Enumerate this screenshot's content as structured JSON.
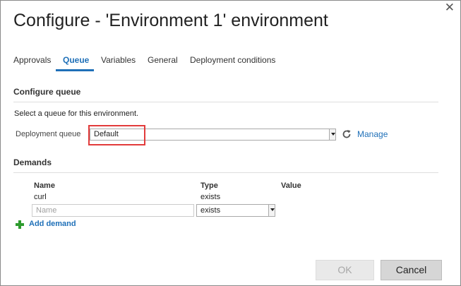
{
  "dialog": {
    "title": "Configure - 'Environment 1' environment",
    "close_label": "✕"
  },
  "tabs": [
    {
      "label": "Approvals",
      "active": false
    },
    {
      "label": "Queue",
      "active": true
    },
    {
      "label": "Variables",
      "active": false
    },
    {
      "label": "General",
      "active": false
    },
    {
      "label": "Deployment conditions",
      "active": false
    }
  ],
  "queue_section": {
    "title": "Configure queue",
    "instruction": "Select a queue for this environment.",
    "field_label": "Deployment queue",
    "selected_value": "Default",
    "manage_label": "Manage"
  },
  "demands_section": {
    "title": "Demands",
    "columns": [
      "Name",
      "Type",
      "Value"
    ],
    "rows": [
      {
        "name": "curl",
        "type": "exists"
      }
    ],
    "new_row": {
      "name_placeholder": "Name",
      "type_value": "exists"
    },
    "add_label": "Add demand"
  },
  "buttons": {
    "ok_label": "OK",
    "cancel_label": "Cancel"
  },
  "colors": {
    "accent": "#1f70b8",
    "highlight": "#e23b3b",
    "add_icon": "#2e9b2e"
  }
}
